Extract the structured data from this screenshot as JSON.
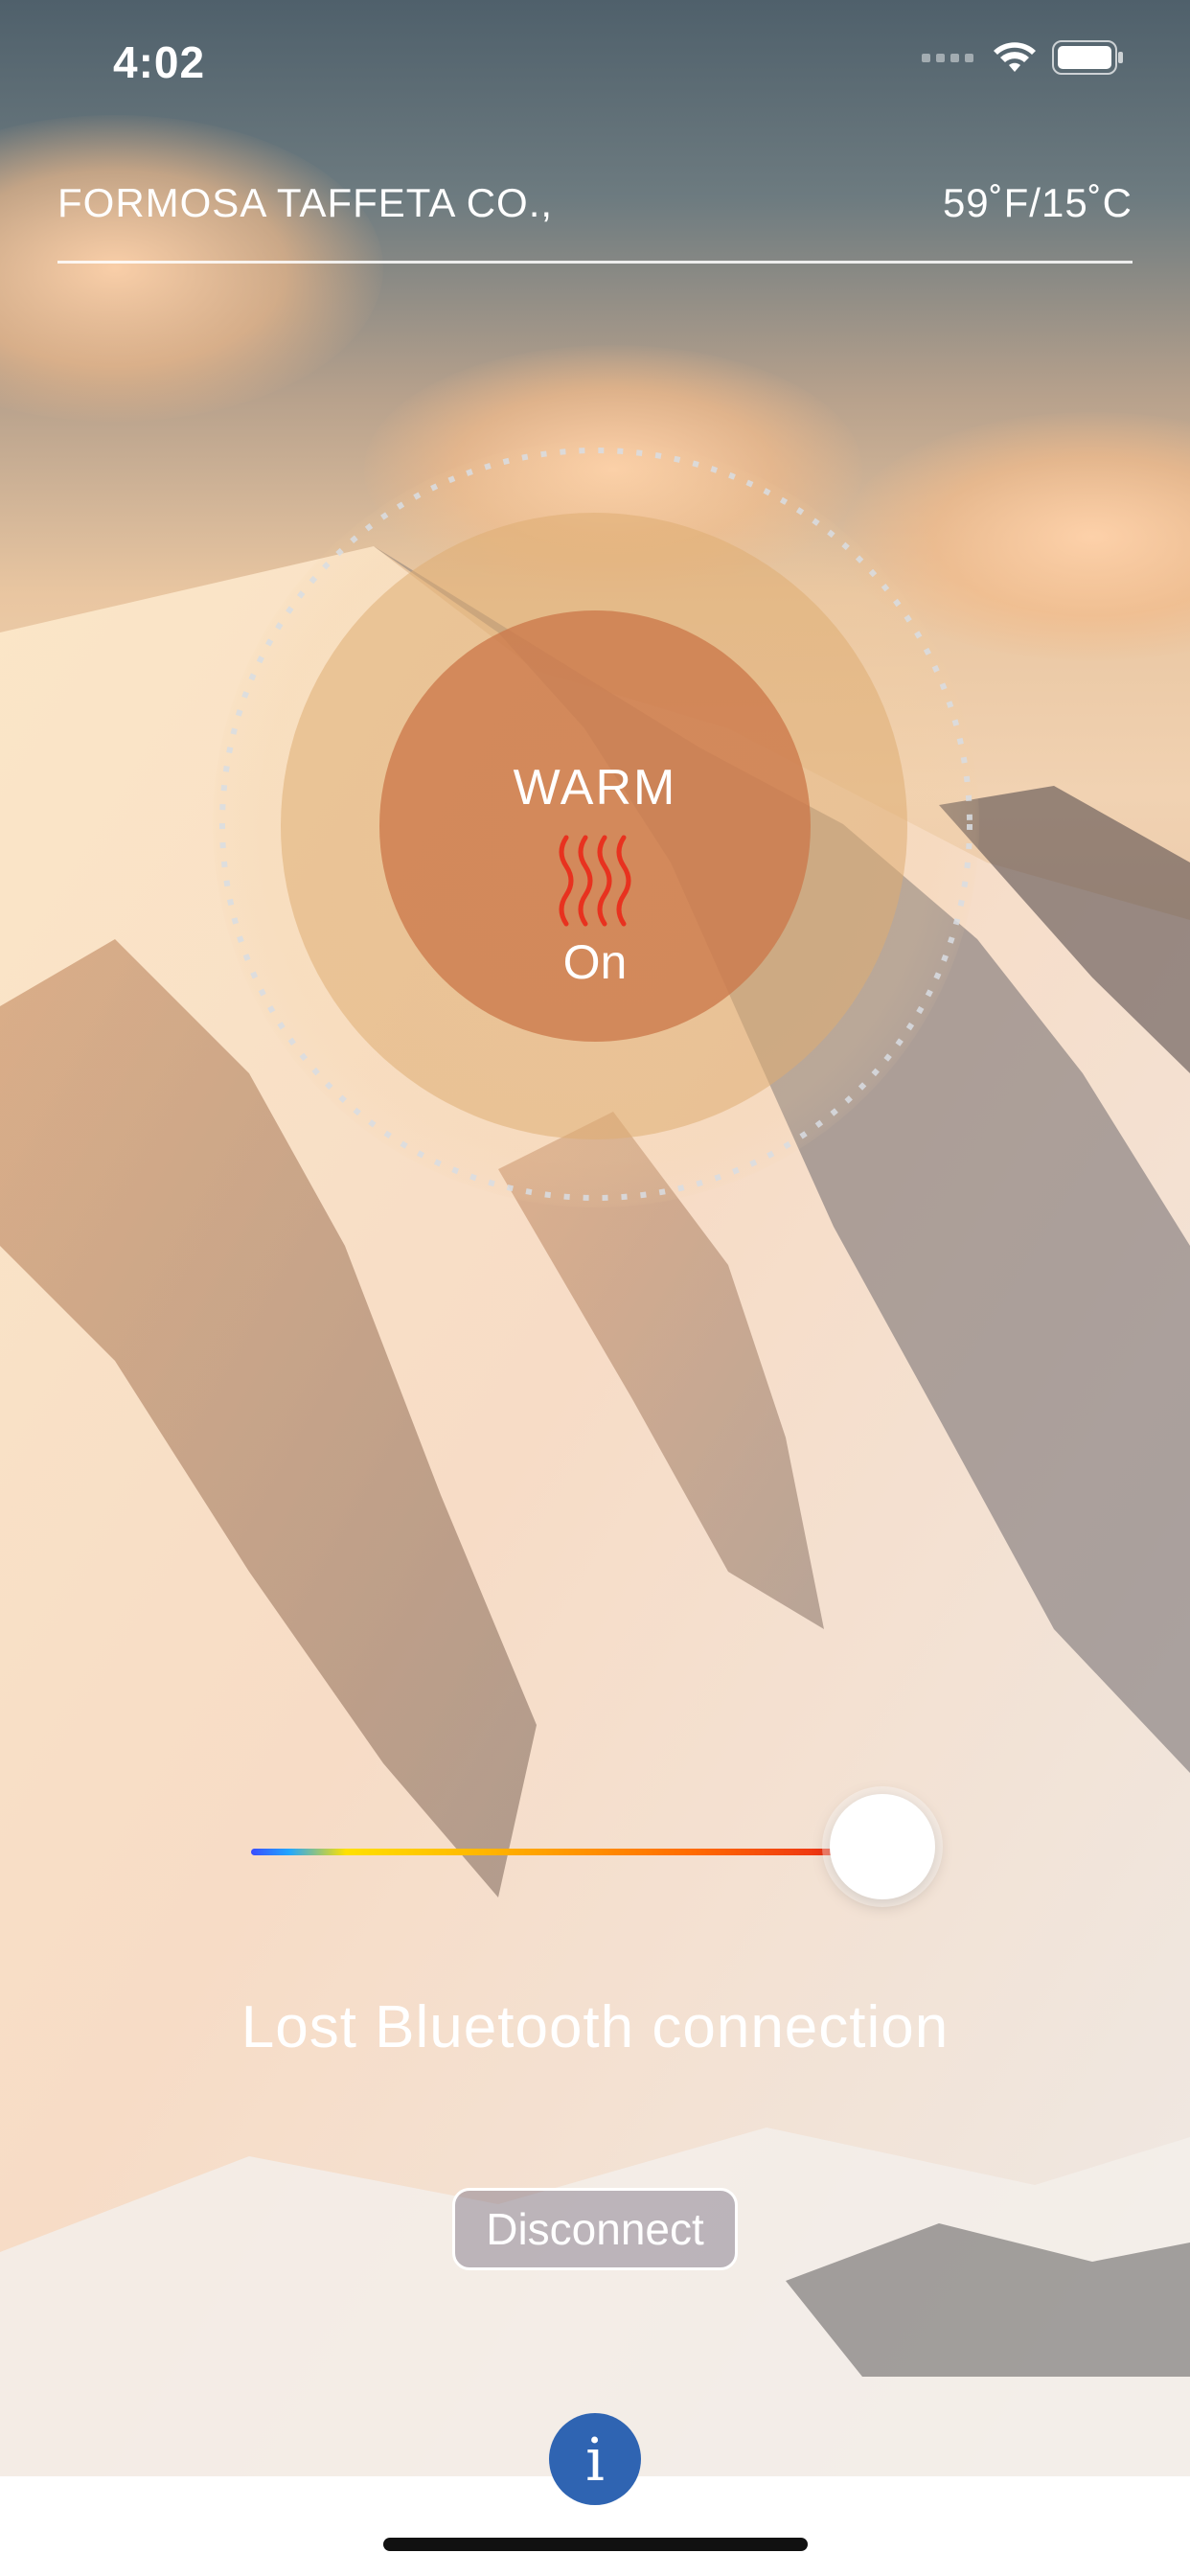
{
  "status_bar": {
    "time": "4:02"
  },
  "header": {
    "title": "FORMOSA TAFFETA CO.,",
    "temperature": "59˚F/15˚C"
  },
  "dial": {
    "mode_label": "WARM",
    "power_label": "On",
    "icon": "heat-waves-icon"
  },
  "slider": {
    "level_fraction": 1.0
  },
  "connection": {
    "status_text": "Lost Bluetooth connection"
  },
  "actions": {
    "disconnect_label": "Disconnect",
    "info_label": "i"
  },
  "colors": {
    "accent_blue": "#2f64b2",
    "heat_red": "#e8321f",
    "ring_inner": "#cc784a",
    "ring_mid": "#dfad73"
  }
}
